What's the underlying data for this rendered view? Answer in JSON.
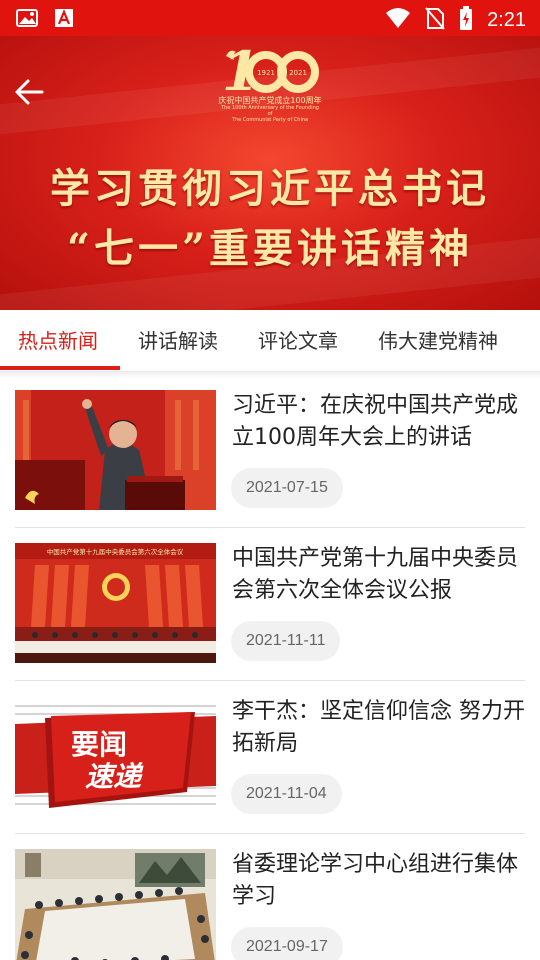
{
  "status_bar": {
    "time": "2:21",
    "bg_color": "#e0130f",
    "icons": [
      "gallery-icon",
      "pdf-icon",
      "wifi-icon",
      "no-sim-icon",
      "battery-charging-icon"
    ]
  },
  "banner": {
    "logo_number": "100",
    "logo_years_left": "1921",
    "logo_years_right": "2021",
    "logo_caption_cn": "庆祝中国共产党成立100周年",
    "logo_caption_en_1": "The 100th Anniversary of the Founding of",
    "logo_caption_en_2": "The Communist Party of China",
    "title_line1": "学习贯彻习近平总书记",
    "title_line2": "“七一”重要讲话精神",
    "back_icon": "arrow-left-icon"
  },
  "tabs": [
    {
      "label": "热点新闻",
      "active": true
    },
    {
      "label": "讲话解读",
      "active": false
    },
    {
      "label": "评论文章",
      "active": false
    },
    {
      "label": "伟大建党精神",
      "active": false
    }
  ],
  "accent_color": "#d8201a",
  "news": [
    {
      "title": "习近平：在庆祝中国共产党成立100周年大会上的讲话",
      "date": "2021-07-15"
    },
    {
      "title": "中国共产党第十九届中央委员会第六次全体会议公报",
      "date": "2021-11-11",
      "banner_text": "中国共产党第十九届中央委员会第六次全体会议"
    },
    {
      "title": "李干杰：坚定信仰信念 努力开拓新局",
      "date": "2021-11-04",
      "badge_line1": "要闻",
      "badge_line2": "速递"
    },
    {
      "title": "省委理论学习中心组进行集体学习",
      "date": "2021-09-17"
    }
  ]
}
